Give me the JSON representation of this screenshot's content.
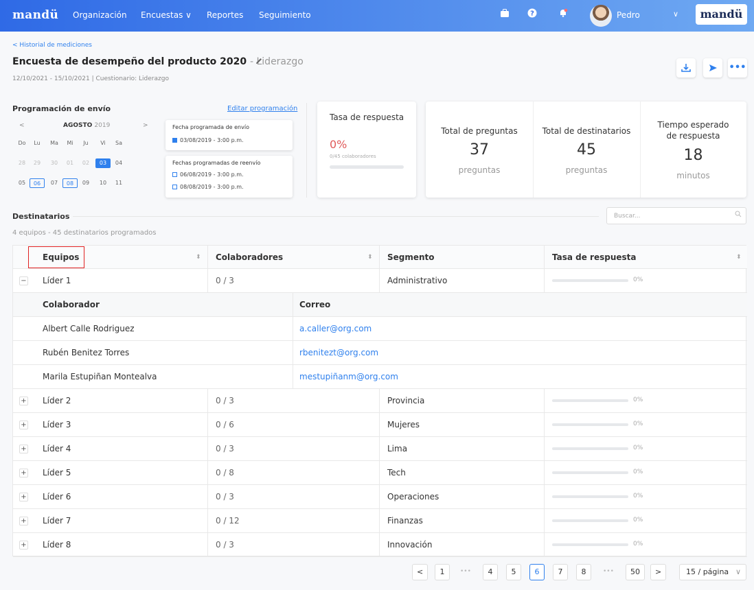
{
  "header": {
    "brand": "mandü",
    "nav": [
      "Organización",
      "Encuestas ∨",
      "Reportes",
      "Seguimiento"
    ],
    "user_name": "Pedro",
    "right_brand": "mandü"
  },
  "page": {
    "back_link": "< Historial de mediciones",
    "title": "Encuesta de desempeño del producto 2020",
    "title_sub": "- Liderazgo",
    "meta": "12/10/2021 - 15/10/2021  |  Cuestionario: Liderazgo"
  },
  "schedule": {
    "title": "Programación de envío",
    "edit_link": "Editar programación",
    "month": "AGOSTO",
    "year": "2019",
    "weekdays": [
      "Do",
      "Lu",
      "Ma",
      "Mi",
      "Ju",
      "Vi",
      "Sa"
    ],
    "week1": [
      "28",
      "29",
      "30",
      "01",
      "02",
      "03",
      "04"
    ],
    "week2": [
      "05",
      "06",
      "07",
      "08",
      "09",
      "10",
      "11"
    ],
    "send_title": "Fecha programada de envío",
    "send_date": "03/08/2019 - 3:00 p.m.",
    "resend_title": "Fechas programadas de reenvío",
    "resend_dates": [
      "06/08/2019 - 3:00 p.m.",
      "08/08/2019 - 3:00 p.m."
    ]
  },
  "response_card": {
    "title": "Tasa de respuesta",
    "value": "0%",
    "detail": "0/45 colaboradores",
    "progress": 0
  },
  "stats": [
    {
      "title": "Total de preguntas",
      "value": "37",
      "unit": "preguntas"
    },
    {
      "title": "Total de destinatarios",
      "value": "45",
      "unit": "preguntas"
    },
    {
      "title": "Tiempo esperado de respuesta",
      "value": "18",
      "unit": "minutos"
    }
  ],
  "recipients": {
    "title": "Destinatarios",
    "summary": "4 equipos - 45 destinatarios programados",
    "search_placeholder": "Buscar..."
  },
  "table": {
    "headers": [
      "Equipos",
      "Colaboradores",
      "Segmento",
      "Tasa de respuesta"
    ],
    "sub_headers": [
      "Colaborador",
      "Correo"
    ],
    "expanded": {
      "name": "Líder 1",
      "collab": "0 / 3",
      "segment": "Administrativo",
      "rate": "0%",
      "members": [
        {
          "name": "Albert Calle Rodriguez",
          "email": "a.caller@org.com"
        },
        {
          "name": "Rubén Benitez Torres",
          "email": "rbenitezt@org.com"
        },
        {
          "name": "Marila Estupiñan Montealva",
          "email": "mestupiñanm@org.com"
        }
      ]
    },
    "rows": [
      {
        "name": "Líder 2",
        "collab": "0 / 3",
        "segment": "Provincia",
        "rate": "0%"
      },
      {
        "name": "Líder 3",
        "collab": "0 / 6",
        "segment": "Mujeres",
        "rate": "0%"
      },
      {
        "name": "Líder 4",
        "collab": "0 / 3",
        "segment": "Lima",
        "rate": "0%"
      },
      {
        "name": "Líder 5",
        "collab": "0 / 8",
        "segment": "Tech",
        "rate": "0%"
      },
      {
        "name": "Líder 6",
        "collab": "0 / 3",
        "segment": "Operaciones",
        "rate": "0%"
      },
      {
        "name": "Líder 7",
        "collab": "0 / 12",
        "segment": "Finanzas",
        "rate": "0%"
      },
      {
        "name": "Líder 8",
        "collab": "0 / 3",
        "segment": "Innovación",
        "rate": "0%"
      }
    ]
  },
  "pagination": {
    "pages": [
      "1",
      "4",
      "5",
      "6",
      "7",
      "8",
      "50"
    ],
    "current": "6",
    "dots": "•••",
    "page_size": "15 / página"
  },
  "colors": {
    "accent": "#2f80ed",
    "danger": "#e05a5a",
    "highlight_box": "#e02020"
  }
}
